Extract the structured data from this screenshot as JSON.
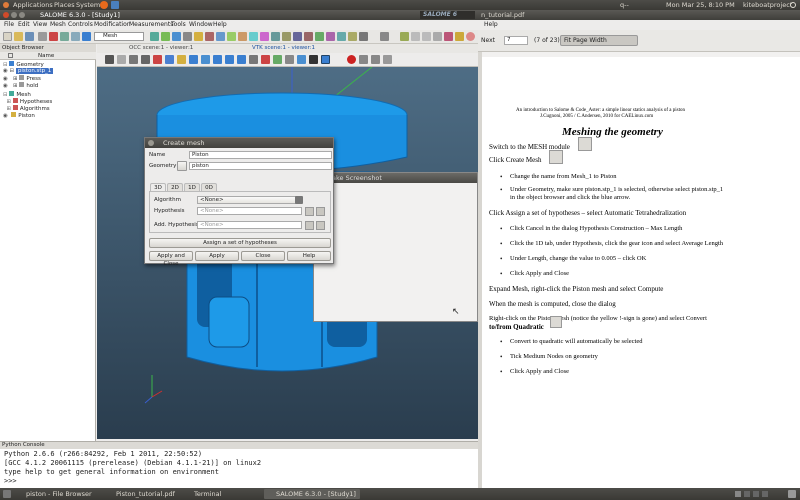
{
  "top_panel": {
    "menus": [
      "Applications",
      "Places",
      "System"
    ],
    "user": "kiteboatproject",
    "datetime": "Mon Mar 25,  8:10 PM",
    "indicator": "q--"
  },
  "salome": {
    "title": "SALOME 6.3.0 - [Study1]",
    "brand": "SALOME 6",
    "menu": [
      "File",
      "Edit",
      "View",
      "Mesh",
      "Controls",
      "Modification",
      "Measurements",
      "Tools",
      "Window",
      "Help"
    ],
    "module_select": "Mesh",
    "object_browser": {
      "title": "Object Browser",
      "column": "Name",
      "items": [
        {
          "label": "Geometry",
          "level": 1
        },
        {
          "label": "piston.stp_1",
          "level": 2,
          "selected": true
        },
        {
          "label": "Press",
          "level": 3
        },
        {
          "label": "hold",
          "level": 3
        },
        {
          "label": "Mesh",
          "level": 1
        },
        {
          "label": "Hypotheses",
          "level": 2
        },
        {
          "label": "Algorithms",
          "level": 2
        },
        {
          "label": "Piston",
          "level": 2
        }
      ]
    },
    "viewer_tabs": [
      "OCC scene:1 - viewer:1",
      "VTK scene:1 - viewer:1"
    ],
    "python_console": {
      "title": "Python Console",
      "lines": [
        "Python 2.6.6 (r266:84292, Feb  1 2011, 22:50:52)",
        "[GCC 4.1.2 20061115 (prerelease) (Debian 4.1.1-21)] on linux2",
        "type help to get general information on environment",
        ">>>"
      ]
    }
  },
  "create_mesh": {
    "title": "Create mesh",
    "name_label": "Name",
    "name_value": "Piston",
    "geometry_label": "Geometry",
    "geometry_value": "piston",
    "tabs": [
      "3D",
      "2D",
      "1D",
      "0D"
    ],
    "algorithm_label": "Algorithm",
    "algorithm_value": "<None>",
    "hypothesis_label": "Hypothesis",
    "hypothesis_value": "<None>",
    "add_hypothesis_label": "Add. Hypothesis",
    "add_hypothesis_value": "<None>",
    "assign_button": "Assign a set of hypotheses",
    "buttons": [
      "Apply and Close",
      "Apply",
      "Close",
      "Help"
    ]
  },
  "screenshot_window": {
    "title": "ake Screenshot"
  },
  "pdf": {
    "title": "n_tutorial.pdf",
    "menu_help": "Help",
    "next_label": "Next",
    "page_number": "7",
    "page_count": "(7 of 23)",
    "zoom": "Fit Page Width",
    "header_line1": "An introduction to Salome & Code_Aster: a simple linear statics analysis of a piston",
    "header_line2": "J.Cugnoni, 2005 / C.Andersen, 2010 for CAELinux.com",
    "heading": "Meshing the geometry",
    "lines": [
      {
        "text": "Switch to the MESH module",
        "indent": 0
      },
      {
        "text": "Click Create Mesh",
        "indent": 0
      },
      {
        "text": "Change the name from Mesh_1 to Piston",
        "indent": 1
      },
      {
        "text": "Under Geometry, make sure piston.stp_1 is selected, otherwise select piston.stp_1",
        "indent": 1
      },
      {
        "text": "in the object browser and click the blue arrow.",
        "indent": 2
      },
      {
        "text": "Click Assign a set of hypotheses – select Automatic Tetrahedralization",
        "indent": 0
      },
      {
        "text": "Click Cancel in the dialog Hypothesis Construction – Max Length",
        "indent": 1
      },
      {
        "text": "Click the 1D tab, under Hypothesis, click the gear icon and select Average Length",
        "indent": 1
      },
      {
        "text": "Under Length, change the value to 0.005 – click OK",
        "indent": 1
      },
      {
        "text": "Click Apply and Close",
        "indent": 1
      },
      {
        "text": "Expand Mesh, right-click the Piston mesh and select Compute",
        "indent": 0
      },
      {
        "text": "When the mesh is computed, close the dialog",
        "indent": 0
      },
      {
        "text": "Right-click on the Piston mesh (notice the yellow !-sign is gone) and select Convert",
        "indent": 0
      },
      {
        "text": "to/from Quadratic",
        "indent": 0
      },
      {
        "text": "Convert to quadratic will automatically be selected",
        "indent": 1
      },
      {
        "text": "Tick Medium Nodes on geometry",
        "indent": 1
      },
      {
        "text": "Click Apply and Close",
        "indent": 1
      }
    ]
  },
  "taskbar": {
    "items": [
      "piston - File Browser",
      "Piston_tutorial.pdf",
      "Terminal",
      "SALOME 6.3.0 - [Study1]"
    ]
  },
  "colors": {
    "piston": "#1a8fe0",
    "viewport_top": "#4e6d85",
    "selection": "#3d6fc2"
  }
}
